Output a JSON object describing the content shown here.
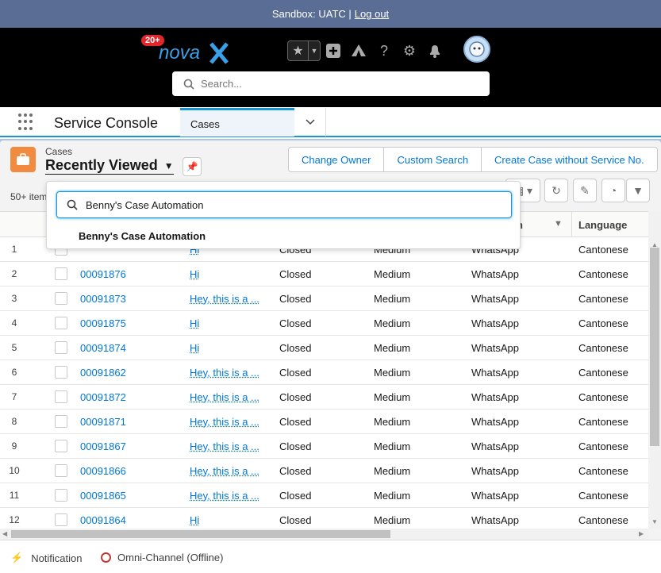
{
  "sandbox": {
    "text": "Sandbox: UATC |",
    "logout": "Log out"
  },
  "header": {
    "logo_text": "nova",
    "badge": "20+",
    "search_placeholder": "Search..."
  },
  "nav": {
    "app_name": "Service Console",
    "tab_label": "Cases"
  },
  "listview": {
    "object_label": "Cases",
    "view_name": "Recently Viewed",
    "item_count": "50+ item",
    "buttons": [
      "Change Owner",
      "Custom Search",
      "Create Case without Service No."
    ]
  },
  "search_dropdown": {
    "query": "Benny's Case Automation",
    "option": "Benny's Case Automation"
  },
  "table": {
    "header_partial": "n",
    "header_language": "Language",
    "rows": [
      {
        "n": "1",
        "case": "",
        "subject": "Hi",
        "status": "Closed",
        "priority": "Medium",
        "origin": "WhatsApp",
        "language": "Cantonese"
      },
      {
        "n": "2",
        "case": "00091876",
        "subject": "Hi",
        "status": "Closed",
        "priority": "Medium",
        "origin": "WhatsApp",
        "language": "Cantonese"
      },
      {
        "n": "3",
        "case": "00091873",
        "subject": "Hey, this is a ...",
        "status": "Closed",
        "priority": "Medium",
        "origin": "WhatsApp",
        "language": "Cantonese"
      },
      {
        "n": "4",
        "case": "00091875",
        "subject": "Hi",
        "status": "Closed",
        "priority": "Medium",
        "origin": "WhatsApp",
        "language": "Cantonese"
      },
      {
        "n": "5",
        "case": "00091874",
        "subject": "Hi",
        "status": "Closed",
        "priority": "Medium",
        "origin": "WhatsApp",
        "language": "Cantonese"
      },
      {
        "n": "6",
        "case": "00091862",
        "subject": "Hey, this is a ...",
        "status": "Closed",
        "priority": "Medium",
        "origin": "WhatsApp",
        "language": "Cantonese"
      },
      {
        "n": "7",
        "case": "00091872",
        "subject": "Hey, this is a ...",
        "status": "Closed",
        "priority": "Medium",
        "origin": "WhatsApp",
        "language": "Cantonese"
      },
      {
        "n": "8",
        "case": "00091871",
        "subject": "Hey, this is a ...",
        "status": "Closed",
        "priority": "Medium",
        "origin": "WhatsApp",
        "language": "Cantonese"
      },
      {
        "n": "9",
        "case": "00091867",
        "subject": "Hey, this is a ...",
        "status": "Closed",
        "priority": "Medium",
        "origin": "WhatsApp",
        "language": "Cantonese"
      },
      {
        "n": "10",
        "case": "00091866",
        "subject": "Hey, this is a ...",
        "status": "Closed",
        "priority": "Medium",
        "origin": "WhatsApp",
        "language": "Cantonese"
      },
      {
        "n": "11",
        "case": "00091865",
        "subject": "Hey, this is a ...",
        "status": "Closed",
        "priority": "Medium",
        "origin": "WhatsApp",
        "language": "Cantonese"
      },
      {
        "n": "12",
        "case": "00091864",
        "subject": "Hi",
        "status": "Closed",
        "priority": "Medium",
        "origin": "WhatsApp",
        "language": "Cantonese"
      }
    ]
  },
  "footer": {
    "notification": "Notification",
    "omni": "Omni-Channel (Offline)"
  }
}
